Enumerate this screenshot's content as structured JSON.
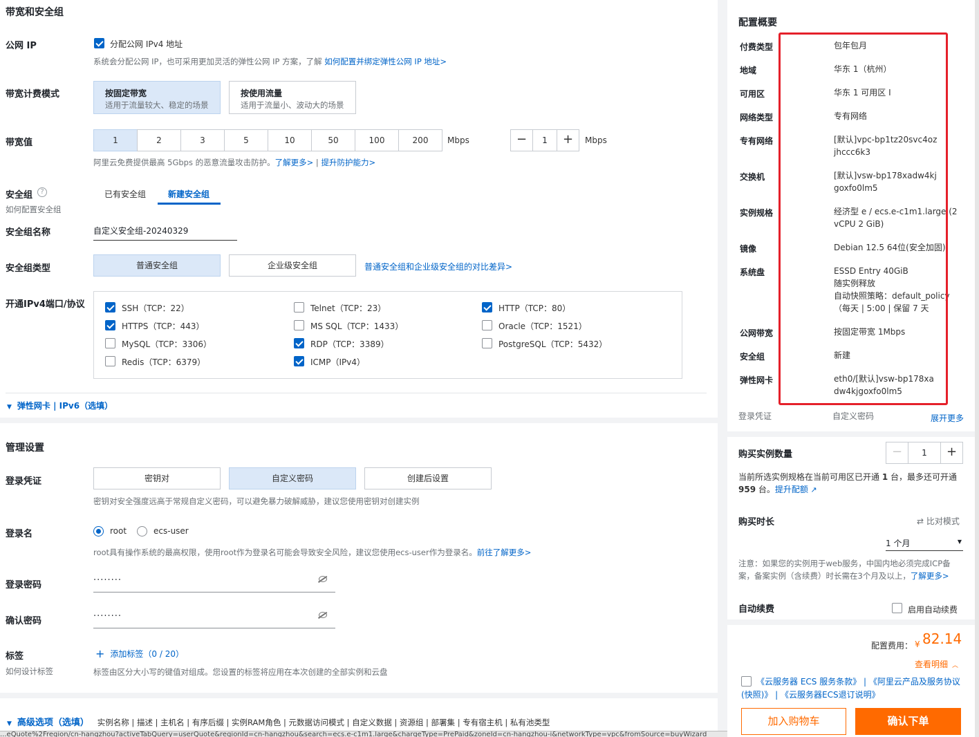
{
  "bandwidth": {
    "section_title": "带宽和安全组",
    "public_ip_label": "公网 IP",
    "public_ip_checkbox": "分配公网 IPv4 地址",
    "public_ip_hint": "系统会分配公网 IP，也可采用更加灵活的弹性公网 IP 方案，了解 ",
    "public_ip_link": "如何配置并绑定弹性公网 IP 地址>",
    "billing_label": "带宽计费模式",
    "billing_options": [
      {
        "title": "按固定带宽",
        "desc": "适用于流量较大、稳定的场景",
        "selected": true
      },
      {
        "title": "按使用流量",
        "desc": "适用于流量小、波动大的场景",
        "selected": false
      }
    ],
    "value_label": "带宽值",
    "values": [
      "1",
      "2",
      "3",
      "5",
      "10",
      "50",
      "100",
      "200"
    ],
    "selected_value": "1",
    "unit": "Mbps",
    "stepper_value": "1",
    "stepper_unit": "Mbps",
    "protect_hint": "阿里云免费提供最高 5Gbps 的恶意流量攻击防护。",
    "protect_link1": "了解更多>",
    "protect_sep": " | ",
    "protect_link2": "提升防护能力>"
  },
  "security_group": {
    "label": "安全组",
    "help_link": "如何配置安全组",
    "tabs": [
      {
        "label": "已有安全组",
        "active": false
      },
      {
        "label": "新建安全组",
        "active": true
      }
    ],
    "name_label": "安全组名称",
    "name_value": "自定义安全组-20240329",
    "type_label": "安全组类型",
    "type_options": [
      {
        "label": "普通安全组",
        "selected": true
      },
      {
        "label": "企业级安全组",
        "selected": false
      }
    ],
    "type_link": "普通安全组和企业级安全组的对比差异>",
    "ports_label": "开通IPv4端口/协议",
    "ports": [
      {
        "label": "SSH（TCP：22）",
        "checked": true
      },
      {
        "label": "Telnet（TCP：23）",
        "checked": false
      },
      {
        "label": "HTTP（TCP：80）",
        "checked": true
      },
      {
        "label": "HTTPS（TCP：443）",
        "checked": true
      },
      {
        "label": "MS SQL（TCP：1433）",
        "checked": false
      },
      {
        "label": "Oracle（TCP：1521）",
        "checked": false
      },
      {
        "label": "MySQL（TCP：3306）",
        "checked": false
      },
      {
        "label": "RDP（TCP：3389）",
        "checked": true
      },
      {
        "label": "PostgreSQL（TCP：5432）",
        "checked": false
      },
      {
        "label": "Redis（TCP：6379）",
        "checked": false
      },
      {
        "label": "ICMP（IPv4）",
        "checked": true
      }
    ],
    "eni_toggle": "弹性网卡 | IPv6（选填）"
  },
  "management": {
    "section_title": "管理设置",
    "credential_label": "登录凭证",
    "credential_options": [
      {
        "label": "密钥对",
        "selected": false
      },
      {
        "label": "自定义密码",
        "selected": true
      },
      {
        "label": "创建后设置",
        "selected": false
      }
    ],
    "credential_hint": "密钥对安全强度远高于常规自定义密码，可以避免暴力破解威胁，建议您使用密钥对创建实例",
    "login_name_label": "登录名",
    "login_names": [
      {
        "label": "root",
        "selected": true
      },
      {
        "label": "ecs-user",
        "selected": false
      }
    ],
    "login_hint": "root具有操作系统的最高权限，使用root作为登录名可能会导致安全风险，建议您使用ecs-user作为登录名。",
    "login_link": "前往了解更多>",
    "password_label": "登录密码",
    "password_value": "········",
    "confirm_label": "确认密码",
    "confirm_value": "········",
    "tags_label": "标签",
    "tags_help": "如何设计标签",
    "tags_add": "添加标签（0 / 20）",
    "tags_hint": "标签由区分大小写的键值对组成。您设置的标签将应用在本次创建的全部实例和云盘",
    "advanced_title": "高级选项（选填）",
    "advanced_items": "实例名称 | 描述 | 主机名 | 有序后缀 | 实例RAM角色 | 元数据访问模式 | 自定义数据 | 资源组 | 部署集 | 专有宿主机 | 私有池类型"
  },
  "status_url": "...eQuote%2Fregion/cn-hangzhou?activeTabQuery=userQuote&regionId=cn-hangzhou&search=ecs.e-c1m1.large&chargeType=PrePaid&zoneId=cn-hangzhou-i&networkType=vpc&fromSource=buyWizard",
  "summary": {
    "title": "配置概要",
    "rows": [
      {
        "key": "付费类型",
        "value": "包年包月"
      },
      {
        "key": "地域",
        "value": "华东 1（杭州）"
      },
      {
        "key": "可用区",
        "value": "华东 1 可用区 I"
      },
      {
        "key": "网络类型",
        "value": "专有网络"
      },
      {
        "key": "专有网络",
        "value": "[默认]vpc-bp1tz20svc4ozjhccc6k3"
      },
      {
        "key": "交换机",
        "value": "[默认]vsw-bp178xadw4kjgoxfo0lm5"
      },
      {
        "key": "实例规格",
        "value": "经济型 e / ecs.e-c1m1.large (2 vCPU 2 GiB)"
      },
      {
        "key": "镜像",
        "value": "Debian 12.5 64位(安全加固)"
      },
      {
        "key": "系统盘",
        "value": "ESSD Entry 40GiB\n随实例释放\n自动快照策略：default_policy（每天 | 5:00 | 保留 7 天"
      },
      {
        "key": "公网带宽",
        "value": "按固定带宽 1Mbps"
      },
      {
        "key": "安全组",
        "value": "新建"
      },
      {
        "key": "弹性网卡",
        "value": "eth0/[默认]vsw-bp178xadw4kjgoxfo0lm5"
      }
    ],
    "credential_key": "登录凭证",
    "credential_value": "自定义密码",
    "expand_link": "展开更多"
  },
  "purchase": {
    "qty_label": "购买实例数量",
    "qty_value": "1",
    "qty_hint_a": "当前所选实例规格在当前可用区已开通 ",
    "qty_hint_b": "1",
    "qty_hint_c": " 台，最多还可开通 ",
    "qty_hint_d": "959",
    "qty_hint_e": " 台。",
    "qty_link": "提升配额",
    "duration_label": "购买时长",
    "compare_mode": "比对模式",
    "duration_value": "1 个月",
    "icp_hint": "注意：如果您的实例用于web服务，中国内地必须完成ICP备案，备案实例（含续费）时长需在3个月及以上，",
    "icp_link": "了解更多>",
    "auto_renew_label": "自动续费",
    "auto_renew_checkbox": "启用自动续费",
    "fee_label": "配置费用：",
    "currency": "¥",
    "fee_value": "82.14",
    "fee_detail": "查看明细",
    "agreements": "《云服务器 ECS 服务条款》 | 《阿里云产品及服务协议(快照)》 | 《云服务器ECS退订说明》",
    "cart_button": "加入购物车",
    "order_button": "确认下单"
  },
  "colors": {
    "accent": "#0064c8",
    "orange": "#ff6a00",
    "highlight": "#e5202a"
  }
}
